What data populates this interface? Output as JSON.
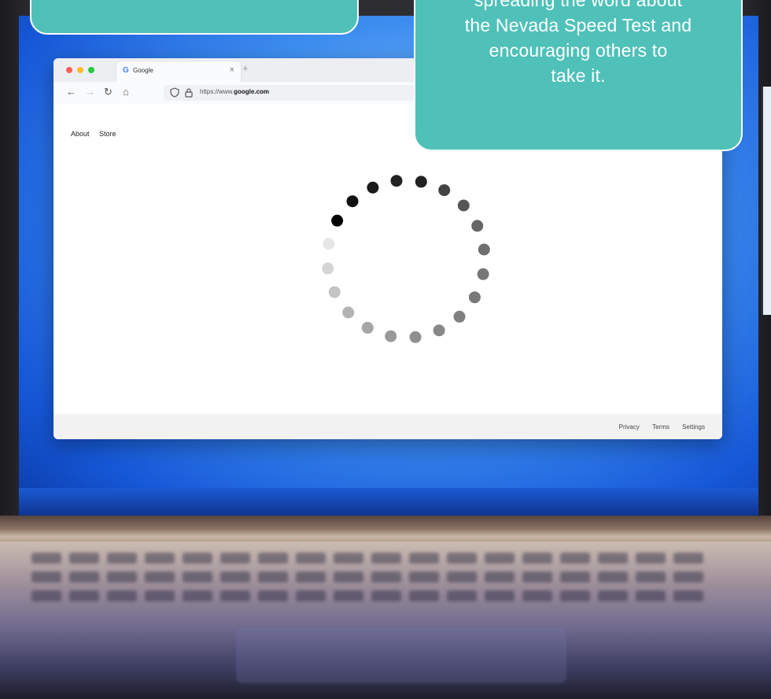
{
  "overlay": {
    "card_right_lines": [
      "spreading the word about",
      "the Nevada Speed Test and",
      "encouraging others to",
      "take it."
    ]
  },
  "browser": {
    "tab_title": "Google",
    "tab_favicon": "G",
    "url_prefix": "https://www.",
    "url_domain": "google.com",
    "top_links": [
      "About",
      "Store"
    ],
    "footer_links": [
      "Privacy",
      "Terms",
      "Settings"
    ]
  },
  "colors": {
    "card": "#4fc1b9",
    "screen_blue": "#1658d8",
    "traffic_red": "#ff5f57",
    "traffic_yellow": "#febc2e",
    "traffic_green": "#28c840"
  },
  "icons": {
    "back": "arrow-left-icon",
    "forward": "arrow-right-icon",
    "reload": "reload-icon",
    "home": "home-icon",
    "shield": "shield-icon",
    "lock": "lock-icon",
    "spinner": "loading-spinner"
  }
}
